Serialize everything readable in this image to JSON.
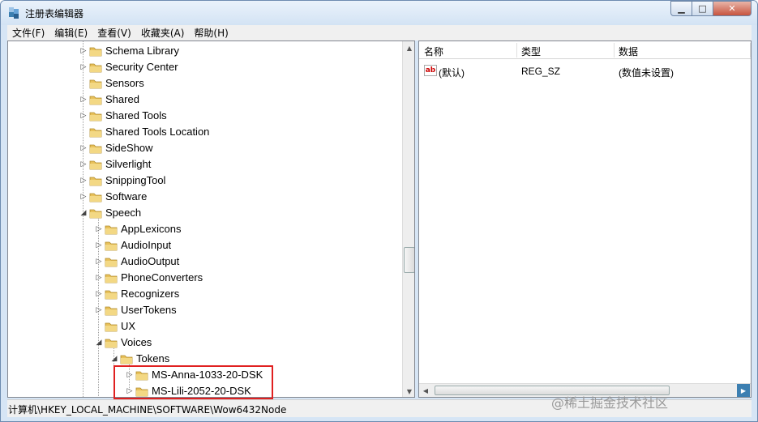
{
  "window": {
    "title": "注册表编辑器",
    "controls": {
      "minimize": "▁",
      "maximize": "□",
      "close": "✕"
    }
  },
  "menu": [
    "文件(F)",
    "编辑(E)",
    "查看(V)",
    "收藏夹(A)",
    "帮助(H)"
  ],
  "tree": {
    "items": [
      {
        "label": "Schema Library",
        "expander": "▷",
        "level": 0
      },
      {
        "label": "Security Center",
        "expander": "▷",
        "level": 0
      },
      {
        "label": "Sensors",
        "expander": "",
        "level": 0
      },
      {
        "label": "Shared",
        "expander": "▷",
        "level": 0
      },
      {
        "label": "Shared Tools",
        "expander": "▷",
        "level": 0
      },
      {
        "label": "Shared Tools Location",
        "expander": "",
        "level": 0
      },
      {
        "label": "SideShow",
        "expander": "▷",
        "level": 0
      },
      {
        "label": "Silverlight",
        "expander": "▷",
        "level": 0
      },
      {
        "label": "SnippingTool",
        "expander": "▷",
        "level": 0
      },
      {
        "label": "Software",
        "expander": "▷",
        "level": 0
      },
      {
        "label": "Speech",
        "expander": "◢",
        "level": 0
      },
      {
        "label": "AppLexicons",
        "expander": "▷",
        "level": 1
      },
      {
        "label": "AudioInput",
        "expander": "▷",
        "level": 1
      },
      {
        "label": "AudioOutput",
        "expander": "▷",
        "level": 1
      },
      {
        "label": "PhoneConverters",
        "expander": "▷",
        "level": 1
      },
      {
        "label": "Recognizers",
        "expander": "▷",
        "level": 1
      },
      {
        "label": "UserTokens",
        "expander": "▷",
        "level": 1
      },
      {
        "label": "UX",
        "expander": "",
        "level": 1
      },
      {
        "label": "Voices",
        "expander": "◢",
        "level": 1
      },
      {
        "label": "Tokens",
        "expander": "◢",
        "level": 2
      },
      {
        "label": "MS-Anna-1033-20-DSK",
        "expander": "▷",
        "level": 3
      },
      {
        "label": "MS-Lili-2052-20-DSK",
        "expander": "▷",
        "level": 3
      }
    ]
  },
  "list": {
    "columns": [
      "名称",
      "类型",
      "数据"
    ],
    "rows": [
      {
        "icon": "ab",
        "name": "(默认)",
        "type": "REG_SZ",
        "data": "(数值未设置)"
      }
    ]
  },
  "statusbar": {
    "path": "计算机\\HKEY_LOCAL_MACHINE\\SOFTWARE\\Wow6432Node"
  },
  "watermark": "@稀土掘金技术社区",
  "colors": {
    "highlight": "#e02020",
    "folder": "#e8c15a",
    "accent": "#3c7fb1"
  }
}
